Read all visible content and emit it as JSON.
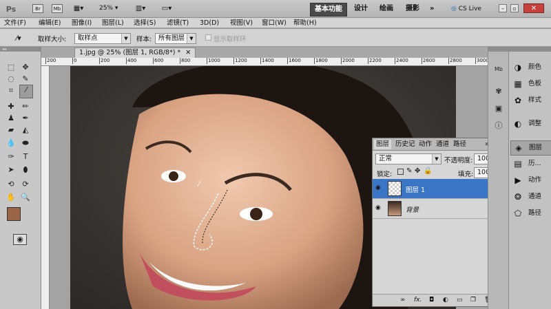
{
  "app": {
    "logo": "Ps",
    "zoom": "25%"
  },
  "workspaces": [
    "基本功能",
    "设计",
    "绘画",
    "摄影"
  ],
  "cslive": "CS Live",
  "menu": [
    "文件(F)",
    "编辑(E)",
    "图像(I)",
    "图层(L)",
    "选择(S)",
    "滤镜(T)",
    "3D(D)",
    "视图(V)",
    "窗口(W)",
    "帮助(H)"
  ],
  "options": {
    "sample_size_label": "取样大小:",
    "sample_size_value": "取样点",
    "sample_label": "样本:",
    "sample_value": "所有图层",
    "show_ring_label": "显示取样环"
  },
  "document": {
    "tab_title": "1.jpg @ 25% (图层 1, RGB/8*) *"
  },
  "ruler_ticks": [
    "200",
    "0",
    "200",
    "400",
    "600",
    "800",
    "1000",
    "1200",
    "1400",
    "1600",
    "1800",
    "2000",
    "2200",
    "2400",
    "2600",
    "2800",
    "3000"
  ],
  "dock": [
    "颜色",
    "色板",
    "样式",
    "调整",
    "图层",
    "历...",
    "动作",
    "通道",
    "路径"
  ],
  "layers_panel": {
    "tabs": [
      "图层",
      "历史记",
      "动作",
      "通道",
      "路径"
    ],
    "blend_mode": "正常",
    "opacity_label": "不透明度:",
    "opacity_value": "100%",
    "lock_label": "锁定:",
    "fill_label": "填充:",
    "fill_value": "100%",
    "layers": [
      {
        "name": "图层 1",
        "selected": true
      },
      {
        "name": "背景",
        "selected": false
      }
    ],
    "footer_fx": "fx."
  },
  "colors": {
    "foreground": "#9a6446",
    "background": "#ffffff",
    "selected_layer": "#3b76c6"
  }
}
